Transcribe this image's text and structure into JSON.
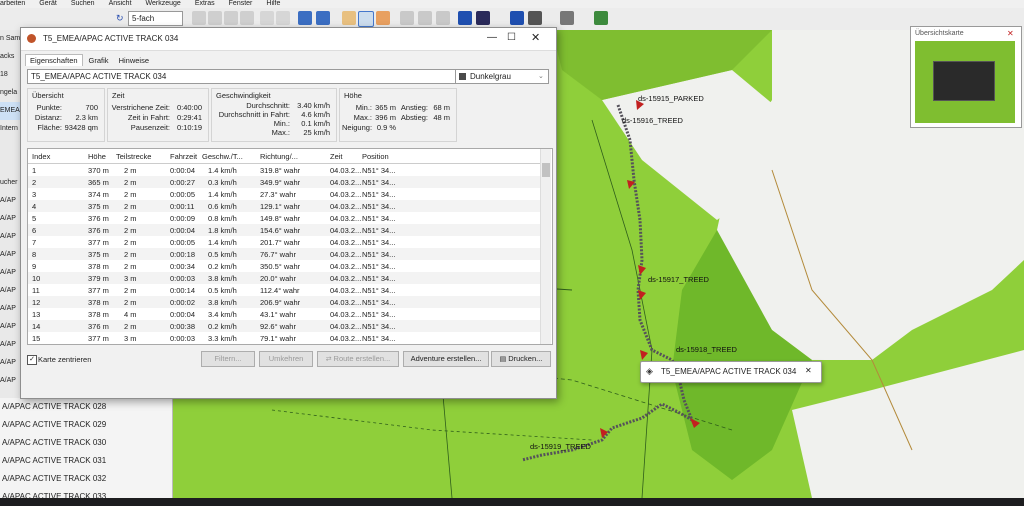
{
  "menubar": [
    "arbeiten",
    "Gerät",
    "Suchen",
    "Ansicht",
    "Werkzeuge",
    "Extras",
    "Fenster",
    "Hilfe"
  ],
  "toolbar": {
    "zoom_value": "5-fach"
  },
  "left_panel": {
    "labels": [
      "n Sam",
      "acks",
      "18",
      "ngela",
      "EMEA",
      "Intern",
      "",
      "",
      "ucher",
      "A/AP",
      "A/AP",
      "A/AP",
      "A/AP",
      "A/AP",
      "A/AP",
      "A/AP",
      "A/AP",
      "A/AP",
      "A/AP",
      "A/AP"
    ],
    "tracks": [
      "A/APAC ACTIVE TRACK 028",
      "A/APAC ACTIVE TRACK 029",
      "A/APAC ACTIVE TRACK 030",
      "A/APAC ACTIVE TRACK 031",
      "A/APAC ACTIVE TRACK 032",
      "A/APAC ACTIVE TRACK 033"
    ]
  },
  "dialog": {
    "title": "T5_EMEA/APAC ACTIVE TRACK 034",
    "tabs": [
      "Eigenschaften",
      "Grafik",
      "Hinweise"
    ],
    "name_value": "T5_EMEA/APAC ACTIVE TRACK 034",
    "color_value": "Dunkelgrau",
    "overview": {
      "heading": "Übersicht",
      "rows": [
        [
          "Punkte:",
          "700"
        ],
        [
          "Distanz:",
          "2.3 km"
        ],
        [
          "Fläche:",
          "93428 qm"
        ]
      ]
    },
    "time": {
      "heading": "Zeit",
      "rows": [
        [
          "Verstrichene Zeit:",
          "0:40:00"
        ],
        [
          "Zeit in Fahrt:",
          "0:29:41"
        ],
        [
          "Pausenzeit:",
          "0:10:19"
        ]
      ]
    },
    "speed": {
      "heading": "Geschwindigkeit",
      "rows": [
        [
          "Durchschnitt:",
          "3.40 km/h"
        ],
        [
          "Durchschnitt in Fahrt:",
          "4.6 km/h"
        ],
        [
          "Min.:",
          "0.1 km/h"
        ],
        [
          "Max.:",
          "25 km/h"
        ]
      ]
    },
    "height": {
      "heading": "Höhe",
      "rows": [
        [
          "Min.:",
          "365 m",
          "Anstieg:",
          "68 m"
        ],
        [
          "Max.:",
          "396 m",
          "Abstieg:",
          "48 m"
        ],
        [
          "Neigung:",
          "0.9 %",
          "",
          ""
        ]
      ]
    },
    "table": {
      "headers": [
        "Index",
        "Höhe",
        "Teilstrecke",
        "Fahrzeit",
        "Geschw./T...",
        "Richtung/...",
        "Zeit",
        "Position"
      ],
      "rows": [
        [
          "1",
          "370 m",
          "2 m",
          "0:00:04",
          "1.4 km/h",
          "319.8° wahr",
          "04.03.2...",
          "N51° 34..."
        ],
        [
          "2",
          "365 m",
          "2 m",
          "0:00:27",
          "0.3 km/h",
          "349.9° wahr",
          "04.03.2...",
          "N51° 34..."
        ],
        [
          "3",
          "374 m",
          "2 m",
          "0:00:05",
          "1.4 km/h",
          "27.3° wahr",
          "04.03.2...",
          "N51° 34..."
        ],
        [
          "4",
          "375 m",
          "2 m",
          "0:00:11",
          "0.6 km/h",
          "129.1° wahr",
          "04.03.2...",
          "N51° 34..."
        ],
        [
          "5",
          "376 m",
          "2 m",
          "0:00:09",
          "0.8 km/h",
          "149.8° wahr",
          "04.03.2...",
          "N51° 34..."
        ],
        [
          "6",
          "376 m",
          "2 m",
          "0:00:04",
          "1.8 km/h",
          "154.6° wahr",
          "04.03.2...",
          "N51° 34..."
        ],
        [
          "7",
          "377 m",
          "2 m",
          "0:00:05",
          "1.4 km/h",
          "201.7° wahr",
          "04.03.2...",
          "N51° 34..."
        ],
        [
          "8",
          "375 m",
          "2 m",
          "0:00:18",
          "0.5 km/h",
          "76.7° wahr",
          "04.03.2...",
          "N51° 34..."
        ],
        [
          "9",
          "378 m",
          "2 m",
          "0:00:34",
          "0.2 km/h",
          "350.5° wahr",
          "04.03.2...",
          "N51° 34..."
        ],
        [
          "10",
          "379 m",
          "3 m",
          "0:00:03",
          "3.8 km/h",
          "20.0° wahr",
          "04.03.2...",
          "N51° 34..."
        ],
        [
          "11",
          "377 m",
          "2 m",
          "0:00:14",
          "0.5 km/h",
          "112.4° wahr",
          "04.03.2...",
          "N51° 34..."
        ],
        [
          "12",
          "378 m",
          "2 m",
          "0:00:02",
          "3.8 km/h",
          "206.9° wahr",
          "04.03.2...",
          "N51° 34..."
        ],
        [
          "13",
          "378 m",
          "4 m",
          "0:00:04",
          "3.4 km/h",
          "43.1° wahr",
          "04.03.2...",
          "N51° 34..."
        ],
        [
          "14",
          "376 m",
          "2 m",
          "0:00:38",
          "0.2 km/h",
          "92.6° wahr",
          "04.03.2...",
          "N51° 34..."
        ],
        [
          "15",
          "377 m",
          "3 m",
          "0:00:03",
          "3.3 km/h",
          "79.1° wahr",
          "04.03.2...",
          "N51° 34..."
        ]
      ]
    },
    "center_map_label": "Karte zentrieren",
    "buttons": {
      "filter": "Filtern...",
      "reverse": "Umkehren",
      "route": "Route erstellen...",
      "adventure": "Adventure erstellen...",
      "print": "Drucken..."
    }
  },
  "map": {
    "overview_label": "Übersichtskarte",
    "waypoints": [
      "ds-15915_PARKED",
      "ds-15916_TREED",
      "ds-15917_TREED",
      "ds-15918_TREED",
      "ds-15919_TREED"
    ],
    "popup_label": "T5_EMEA/APAC ACTIVE TRACK 034",
    "colors": {
      "green": "#8fcf3a",
      "light": "#f2f2f2",
      "track": "#55525a",
      "marker": "#c22020"
    }
  }
}
